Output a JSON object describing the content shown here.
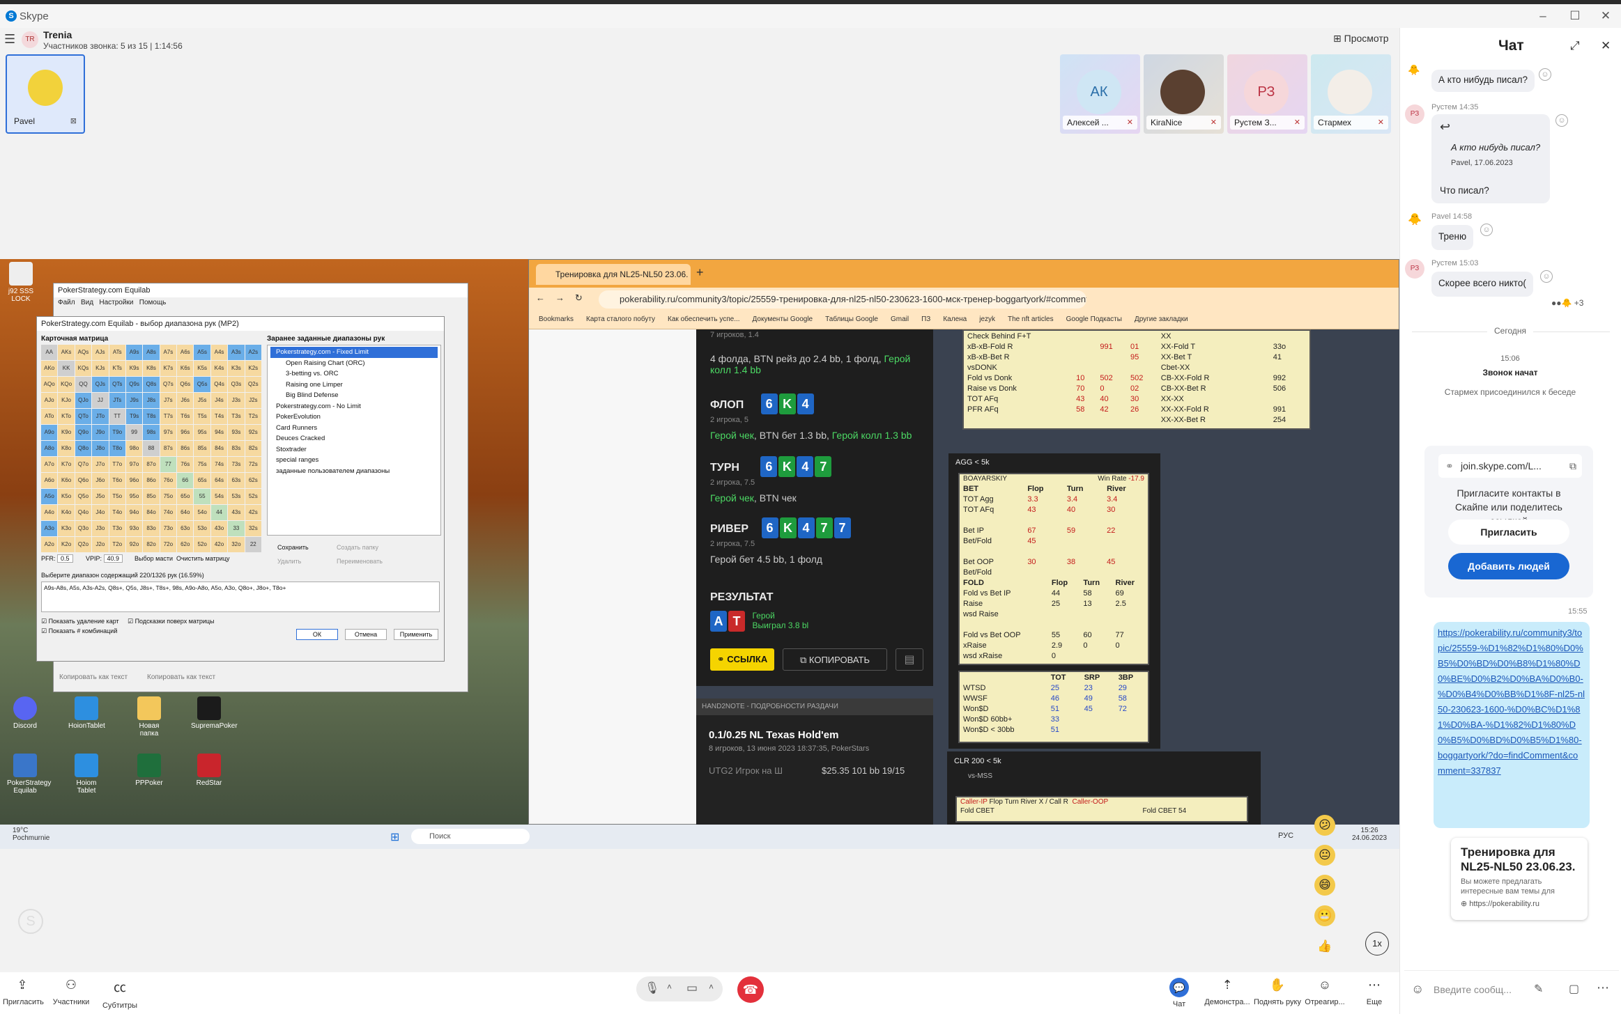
{
  "window": {
    "app_title": "Skype",
    "minimize": "–",
    "maximize": "☐",
    "close": "✕"
  },
  "call": {
    "group_initials": "TR",
    "group_name": "Trenia",
    "subtitle": "Участников звонка: 5 из 15 | 1:14:56",
    "view_label": "Просмотр",
    "self_name": "Pavel",
    "participants": [
      {
        "initials": "АК",
        "name": "Алексей ..."
      },
      {
        "initials": "",
        "name": "KiraNice"
      },
      {
        "initials": "РЗ",
        "name": "Рустем З..."
      },
      {
        "initials": "",
        "name": "Стармех"
      }
    ]
  },
  "desktop": {
    "icons": [
      "j92 SSS LOCK",
      "Discord",
      "HoionTablet",
      "Новая папка",
      "SupremaPoker",
      "PokerStrategy Equilab",
      "Hoiom Tablet",
      "PPPoker",
      "RedStar"
    ],
    "equilab": {
      "title": "PokerStrategy.com Equilab",
      "dialog_title": "PokerStrategy.com Equilab - выбор диапазона рук (MP2)",
      "menu": [
        "Файл",
        "Вид",
        "Настройки",
        "Помощь"
      ],
      "matrix_title": "Карточная матрица",
      "ranges_title": "Заранее заданные диапазоны рук",
      "tree": [
        "Pokerstrategy.com - Fixed Limit",
        "Open Raising Chart (ORC)",
        "3-betting vs. ORC",
        "Raising one Limper",
        "Big Blind Defense",
        "Pokerstrategy.com - No Limit",
        "PokerEvolution",
        "Card Runners",
        "Deuces Cracked",
        "Stoxtrader",
        "special ranges",
        "заданные пользователем диапазоны"
      ],
      "pfr_label": "PFR:",
      "pfr_value": "0.5",
      "vpip_label": "VPIP:",
      "vpip_value": "40.9",
      "suit_btn": "Выбор масти",
      "clear_btn": "Очистить матрицу",
      "save_btn": "Сохранить",
      "create_folder": "Создать папку",
      "delete_btn": "Удалить",
      "rename_btn": "Переименовать",
      "range_label": "Выберите диапазон содержащий 220/1326 рук (16.59%)",
      "range_text": "A9s-A8s, A5s, A3s-A2s, Q8s+, Q5s, J8s+, T8s+, 98s, A9o-A8o, A5o, A3o, Q8o+, J8o+, T8o+",
      "chk1": "Показать удаление карт",
      "chk2": "Подсказки поверх матрицы",
      "chk3": "Показать # комбинаций",
      "ok": "ОК",
      "cancel": "Отмена",
      "apply": "Применить",
      "copy_text": "Копировать как текст",
      "copy_format": "Копировать как текст",
      "grid": [
        [
          "AA",
          "AKs",
          "AQs",
          "AJs",
          "ATs",
          "A9s",
          "A8s",
          "A7s",
          "A6s",
          "A5s",
          "A4s",
          "A3s",
          "A2s"
        ],
        [
          "AKo",
          "KK",
          "KQs",
          "KJs",
          "KTs",
          "K9s",
          "K8s",
          "K7s",
          "K6s",
          "K5s",
          "K4s",
          "K3s",
          "K2s"
        ],
        [
          "AQo",
          "KQo",
          "QQ",
          "QJs",
          "QTs",
          "Q9s",
          "Q8s",
          "Q7s",
          "Q6s",
          "Q5s",
          "Q4s",
          "Q3s",
          "Q2s"
        ],
        [
          "AJo",
          "KJo",
          "QJo",
          "JJ",
          "JTs",
          "J9s",
          "J8s",
          "J7s",
          "J6s",
          "J5s",
          "J4s",
          "J3s",
          "J2s"
        ],
        [
          "ATo",
          "KTo",
          "QTo",
          "JTo",
          "TT",
          "T9s",
          "T8s",
          "T7s",
          "T6s",
          "T5s",
          "T4s",
          "T3s",
          "T2s"
        ],
        [
          "A9o",
          "K9o",
          "Q9o",
          "J9o",
          "T9o",
          "99",
          "98s",
          "97s",
          "96s",
          "95s",
          "94s",
          "93s",
          "92s"
        ],
        [
          "A8o",
          "K8o",
          "Q8o",
          "J8o",
          "T8o",
          "98o",
          "88",
          "87s",
          "86s",
          "85s",
          "84s",
          "83s",
          "82s"
        ],
        [
          "A7o",
          "K7o",
          "Q7o",
          "J7o",
          "T7o",
          "97o",
          "87o",
          "77",
          "76s",
          "75s",
          "74s",
          "73s",
          "72s"
        ],
        [
          "A6o",
          "K6o",
          "Q6o",
          "J6o",
          "T6o",
          "96o",
          "86o",
          "76o",
          "66",
          "65s",
          "64s",
          "63s",
          "62s"
        ],
        [
          "A5o",
          "K5o",
          "Q5o",
          "J5o",
          "T5o",
          "95o",
          "85o",
          "75o",
          "65o",
          "55",
          "54s",
          "53s",
          "52s"
        ],
        [
          "A4o",
          "K4o",
          "Q4o",
          "J4o",
          "T4o",
          "94o",
          "84o",
          "74o",
          "64o",
          "54o",
          "44",
          "43s",
          "42s"
        ],
        [
          "A3o",
          "K3o",
          "Q3o",
          "J3o",
          "T3o",
          "93o",
          "83o",
          "73o",
          "63o",
          "53o",
          "43o",
          "33",
          "32s"
        ],
        [
          "A2o",
          "K2o",
          "Q2o",
          "J2o",
          "T2o",
          "92o",
          "82o",
          "72o",
          "62o",
          "52o",
          "42o",
          "32o",
          "22"
        ]
      ]
    },
    "taskbar": {
      "search": "Поиск",
      "lang": "РУС",
      "time": "15:26",
      "date": "24.06.2023",
      "weather_temp": "19°C",
      "weather_text": "Pochmurnie"
    }
  },
  "browser": {
    "tab_title": "Тренировка для NL25-NL50 23.06.",
    "url": "pokerability.ru/community3/topic/25559-тренировка-для-nl25-nl50-230623-1600-мск-тренер-boggartyork/#comment...",
    "bookmarks": [
      "Bookmarks",
      "Карта сталого побуту",
      "Как обеспечить успе...",
      "Документы Google",
      "Таблицы Google",
      "Gmail",
      "ПЗ",
      "Калена",
      "jezyk",
      "The nft articles",
      "Google Подкасты",
      "Другие закладки"
    ],
    "hand": {
      "preflop_players": "7 игроков, 1.4",
      "preflop_action": "4 фолда, BTN рейз до 2.4 bb, 1 фолд,",
      "preflop_hero": "Герой колл 1.4 bb",
      "flop_label": "ФЛОП",
      "flop_sub": "2 игрока, 5",
      "flop_cards": [
        "6",
        "K",
        "4"
      ],
      "flop_hero": "Герой чек",
      "flop_btn": ", BTN бет 1.3 bb,",
      "flop_hero2": "Герой колл 1.3 bb",
      "turn_label": "ТУРН",
      "turn_sub": "2 игрока, 7.5",
      "turn_cards": [
        "6",
        "K",
        "4",
        "7"
      ],
      "turn_hero": "Герой чек",
      "turn_btn": ", BTN чек",
      "river_label": "РИВЕР",
      "river_sub": "2 игрока, 7.5",
      "river_cards": [
        "6",
        "K",
        "4",
        "7",
        "7"
      ],
      "river_action": "Герой бет 4.5 bb, 1 фолд",
      "result_label": "РЕЗУЛЬТАТ",
      "hero_cards": [
        "A",
        "T"
      ],
      "hero": "Герой",
      "won": "Выиграл 3.8 bl",
      "link_btn": "ССЫЛКА",
      "copy_btn": "КОПИРОВАТЬ",
      "h2n_title": "HAND2NOTE - ПОДРОБНОСТИ РАЗДАЧИ",
      "game": "0.1/0.25 NL Texas Hold'em",
      "game_sub": "8 игроков, 13 июня 2023 18:37:35, PokerStars",
      "utg": "UTG2  Игрок на Ш",
      "utg_amt": "$25.35   101 bb   19/15"
    },
    "hud1": {
      "rows": [
        [
          "Check Behind F+T",
          "",
          "",
          ""
        ],
        [
          "xB-xB-Fold R",
          "",
          "991",
          "01"
        ],
        [
          "xB-xB-Bet R",
          "",
          "",
          "95"
        ],
        [
          "vsDONK",
          "",
          "",
          ""
        ],
        [
          "Fold vs Donk",
          "10",
          "502",
          "502"
        ],
        [
          "Raise vs Donk",
          "70",
          "0",
          "02"
        ],
        [
          "TOT AFq",
          "43",
          "40",
          "30"
        ],
        [
          "PFR AFq",
          "58",
          "42",
          "26"
        ]
      ],
      "right": [
        [
          "XX",
          ""
        ],
        [
          "XX-Fold T",
          "33o"
        ],
        [
          "XX-Bet T",
          "41"
        ],
        [
          "Cbet-XX",
          ""
        ],
        [
          "CB-XX-Fold R",
          "992"
        ],
        [
          "CB-XX-Bet R",
          "506"
        ],
        [
          "XX-XX",
          ""
        ],
        [
          "XX-XX-Fold R",
          "991"
        ],
        [
          "XX-XX-Bet R",
          "254"
        ]
      ]
    },
    "hud2": {
      "title": "AGG < 5k",
      "player": "BOAYARSKIY",
      "wr_label": "Win Rate",
      "wr": "-17.9",
      "head": [
        "BET",
        "Flop",
        "Turn",
        "River"
      ],
      "rows": [
        [
          "TOT Agg",
          "3.3",
          "3.4",
          "3.4"
        ],
        [
          "TOT AFq",
          "43",
          "40",
          "30"
        ],
        [
          "",
          ""
        ],
        [
          "Bet IP",
          "67",
          "59",
          "22"
        ],
        [
          "Bet/Fold",
          "45",
          "",
          ""
        ],
        [
          "",
          ""
        ],
        [
          "Bet OOP",
          "30",
          "38",
          "45"
        ],
        [
          "Bet/Fold",
          "",
          "",
          ""
        ]
      ],
      "fold_head": [
        "FOLD",
        "Flop",
        "Turn",
        "River"
      ],
      "fold_rows": [
        [
          "Fold vs Bet IP",
          "44",
          "58",
          "69"
        ],
        [
          "Raise",
          "25",
          "13",
          "2.5"
        ],
        [
          "wsd Raise",
          "",
          "",
          ""
        ],
        [
          "",
          ""
        ],
        [
          "Fold vs Bet OOP",
          "55",
          "60",
          "77"
        ],
        [
          "xRaise",
          "2.9",
          "0",
          "0"
        ],
        [
          "wsd xRaise",
          "0",
          "",
          ""
        ]
      ],
      "bot_head": [
        "",
        "TOT",
        "SRP",
        "3BP"
      ],
      "bot_rows": [
        [
          "WTSD",
          "25",
          "23",
          "29"
        ],
        [
          "WWSF",
          "46",
          "49",
          "58"
        ],
        [
          "Won$D",
          "51",
          "45",
          "72"
        ],
        [
          "Won$D 60bb+",
          "33",
          "",
          ""
        ],
        [
          "Won$D < 30bb",
          "51",
          "",
          ""
        ]
      ]
    },
    "hud3": {
      "title": "CLR 200 < 5k",
      "vs": "vs-MSS",
      "caller_ip": "Caller-IP",
      "caller_oop": "Caller-OOP",
      "cols": [
        "Flop",
        "Turn",
        "River",
        "X / Call R"
      ],
      "fold_cbet": "Fold CBET",
      "fold_cbet_val": "54"
    }
  },
  "chat": {
    "title": "Чат",
    "messages": [
      {
        "text": "А кто нибудь писал?"
      },
      {
        "author": "Рустем 14:35",
        "quote": "А кто нибудь писал?",
        "quote_meta": "Pavel, 17.06.2023",
        "text": "Что писал?",
        "initials": "РЗ"
      },
      {
        "author": "Pavel 14:58",
        "text": "Треню"
      },
      {
        "author": "Рустем 15:03",
        "text": "Скорее всего никто(",
        "initials": "РЗ"
      }
    ],
    "reactions_more": "+3",
    "today": "Сегодня",
    "call_time": "15:06",
    "call_started": "Звонок начат",
    "joined": "Стармех присоединился к беседе",
    "invite_link": "join.skype.com/L...",
    "invite_text": "Пригласите контакты в Скайпе или поделитесь ссылкой",
    "invite_btn": "Пригласить",
    "add_people_btn": "Добавить людей",
    "link_time": "15:55",
    "link_url": "https://pokerability.ru/community3/topic/25559-%D1%82%D1%80%D0%B5%D0%BD%D0%B8%D1%80%D0%BE%D0%B2%D0%BA%D0%B0-%D0%B4%D0%BB%D1%8F-nl25-nl50-230623-1600-%D0%BC%D1%81%D0%BA-%D1%82%D1%80%D0%B5%D0%BD%D0%B5%D1%80-boggartyork/?do=findComment&comment=337837",
    "preview_title": "Тренировка для NL25-NL50 23.06.23.",
    "preview_desc": "Вы можете предлагать интересные вам темы для",
    "preview_domain": "https://pokerability.ru",
    "compose_placeholder": "Введите сообщ..."
  },
  "controls": {
    "invite": "Пригласить",
    "participants": "Участники",
    "subtitles": "Субтитры",
    "chat": "Чат",
    "share": "Демонстра...",
    "raise_hand": "Поднять руку",
    "react": "Отреагир...",
    "more": "Еще",
    "speed": "1x"
  }
}
